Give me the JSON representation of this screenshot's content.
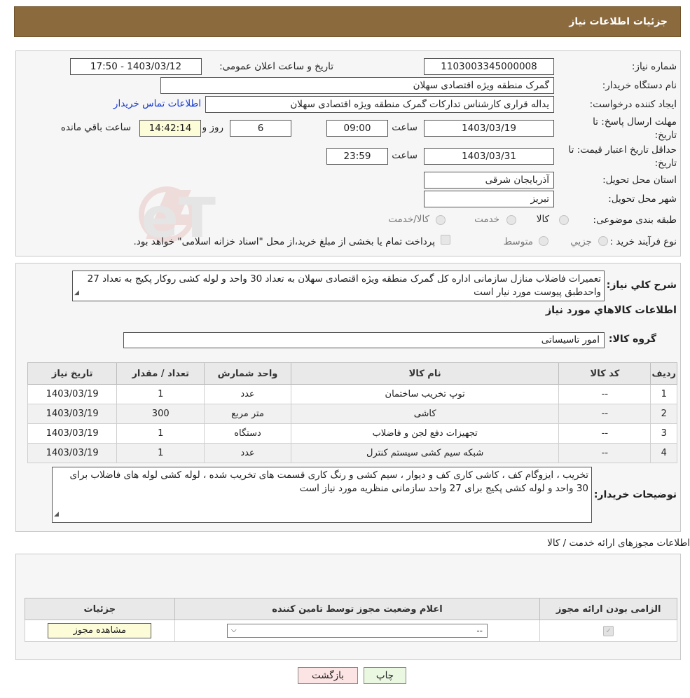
{
  "header": {
    "title": "جزئیات اطلاعات نیاز"
  },
  "info": {
    "need_number_label": "شماره نیاز:",
    "need_number": "1103003345000008",
    "announce_label": "تاریخ و ساعت اعلان عمومی:",
    "announce_value": "1403/03/12 - 17:50",
    "buyer_label": "نام دستگاه خریدار:",
    "buyer_value": "گمرک منطقه ویژه اقتصادی سهلان",
    "creator_label": "ایجاد کننده درخواست:",
    "creator_value": "یداله قراری کارشناس تدارکات گمرک منطقه ویژه اقتصادی سهلان",
    "contact_link": "اطلاعات تماس خریدار",
    "deadline_label_1": "مهلت ارسال پاسخ: تا",
    "deadline_label_2": "تاریخ:",
    "deadline_date": "1403/03/19",
    "time_label": "ساعت",
    "deadline_time": "09:00",
    "days_value": "6",
    "days_label": "روز و",
    "remaining_value": "14:42:14",
    "remaining_label": "ساعت باقي مانده",
    "validity_label_1": "حداقل تاریخ اعتبار قیمت: تا",
    "validity_label_2": "تاریخ:",
    "validity_date": "1403/03/31",
    "validity_time": "23:59",
    "province_label": "استان محل تحویل:",
    "province_value": "آذربایجان شرقی",
    "city_label": "شهر محل تحویل:",
    "city_value": "تبریز",
    "category_label": "طبقه بندی موضوعی:",
    "category_options": [
      "کالا",
      "خدمت",
      "کالا/خدمت"
    ],
    "process_label": "نوع فرآیند خرید :",
    "process_options": [
      "جزیي",
      "متوسط"
    ],
    "process_note": "پرداخت تمام یا بخشی از مبلغ خرید،از محل \"اسناد خزانه اسلامی\" خواهد بود."
  },
  "details": {
    "summary_label": "شرح کلي نیاز:",
    "summary_text": "تعمیرات  فاضلاب منازل سازمانی اداره کل گمرک منطقه ویژه اقتصادی سهلان به تعداد 30 واحد و لوله کشی روکار پکیج به تعداد 27 واحدطبق پیوست مورد نیار است",
    "goods_heading": "اطلاعات کالاهاي مورد نياز",
    "group_label": "گروه کالا:",
    "group_value": "امور تاسیساتی",
    "table_headers": [
      "ردیف",
      "کد کالا",
      "نام کالا",
      "واحد شمارش",
      "تعداد / مقدار",
      "تاریخ نیاز"
    ],
    "table_rows": [
      [
        "1",
        "--",
        "توپ تخریب ساختمان",
        "عدد",
        "1",
        "1403/03/19"
      ],
      [
        "2",
        "--",
        "کاشی",
        "متر مربع",
        "300",
        "1403/03/19"
      ],
      [
        "3",
        "--",
        "تجهیزات دفع لجن و فاضلاب",
        "دستگاه",
        "1",
        "1403/03/19"
      ],
      [
        "4",
        "--",
        "شبکه سیم کشی سیستم کنترل",
        "عدد",
        "1",
        "1403/03/19"
      ]
    ],
    "buyer_notes_label": "توضیحات خریدار:",
    "buyer_notes_text": "تخریب  ، ایزوگام کف ، کاشی کاری کف و دیوار ، سیم کشی و رنگ کاری قسمت های تخریب شده ، لوله کشی لوله های فاضلاب برای 30 واحد و لوله کشی پکیج برای 27 واحد سازمانی منظریه مورد نیاز است"
  },
  "permits": {
    "heading": "اطلاعات مجوزهای ارائه خدمت / کالا",
    "headers": [
      "الزامی بودن ارائه مجوز",
      "اعلام وضعیت مجوز توسط تامین کننده",
      "جزئیات"
    ],
    "select_value": "--",
    "view_button": "مشاهده مجوز"
  },
  "footer": {
    "print_button": "چاپ",
    "back_button": "بازگشت"
  },
  "watermark": {
    "text": "AriaTender.neT"
  },
  "colors": {
    "header_bg": "#8b6a3e",
    "link": "#1a3fd6",
    "back_bg": "#fde4e4",
    "print_bg": "#eaf7e1",
    "remaining_bg": "#fdfcd8"
  }
}
